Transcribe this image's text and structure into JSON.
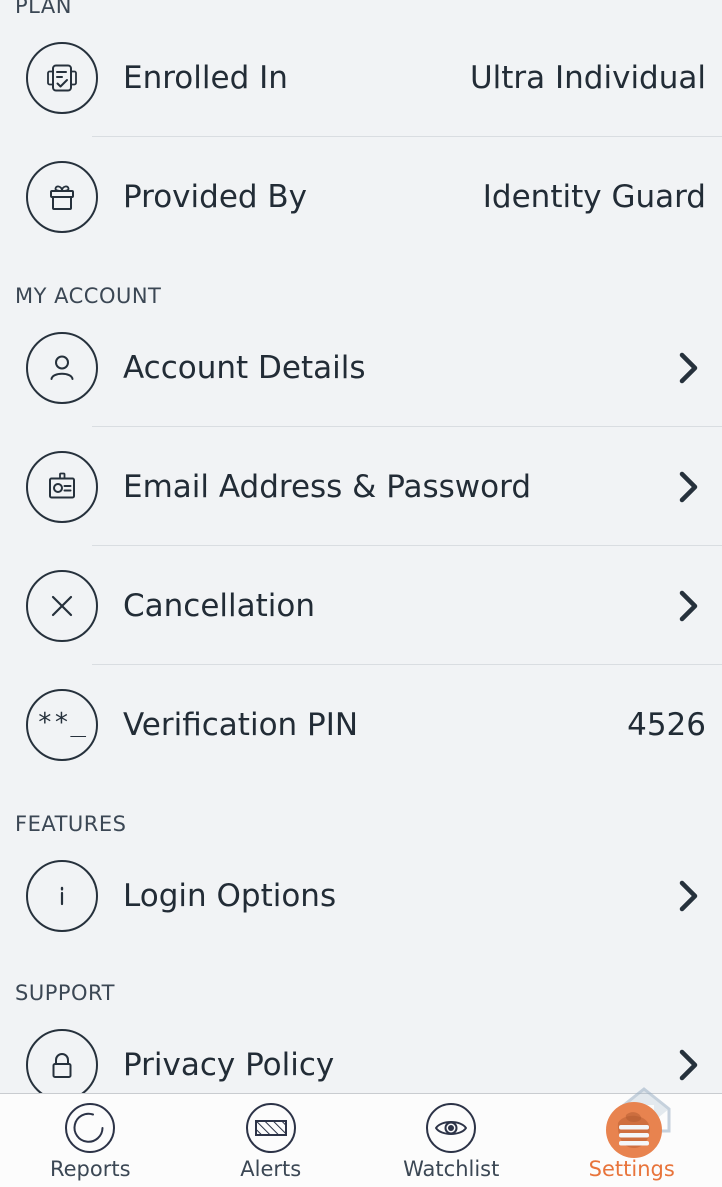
{
  "sections": [
    {
      "id": "plan",
      "header": "PLAN",
      "rows": [
        {
          "icon": "plan-document-icon",
          "label": "Enrolled In",
          "value": "Ultra Individual",
          "accessory": "value",
          "divider": true
        },
        {
          "icon": "gift-icon",
          "label": "Provided By",
          "value": "Identity Guard",
          "accessory": "value",
          "divider": false
        }
      ]
    },
    {
      "id": "my-account",
      "header": "MY ACCOUNT",
      "rows": [
        {
          "icon": "person-icon",
          "label": "Account Details",
          "value": "",
          "accessory": "chevron",
          "divider": true
        },
        {
          "icon": "id-badge-icon",
          "label": "Email Address & Password",
          "value": "",
          "accessory": "chevron",
          "divider": true
        },
        {
          "icon": "close-x-icon",
          "label": "Cancellation",
          "value": "",
          "accessory": "chevron",
          "divider": true
        },
        {
          "icon": "pin-mask-icon",
          "label": "Verification PIN",
          "value": "4526",
          "accessory": "value",
          "divider": false
        }
      ]
    },
    {
      "id": "features",
      "header": "FEATURES",
      "rows": [
        {
          "icon": "info-icon",
          "label": "Login Options",
          "value": "",
          "accessory": "chevron",
          "divider": false
        }
      ]
    },
    {
      "id": "support",
      "header": "SUPPORT",
      "rows": [
        {
          "icon": "lock-icon",
          "label": "Privacy Policy",
          "value": "",
          "accessory": "chevron",
          "divider": true
        }
      ]
    }
  ],
  "pin_icon_glyph": "**_",
  "bottom_nav": {
    "active_color": "#e8743b",
    "items": [
      {
        "id": "reports",
        "label": "Reports",
        "icon": "reports-gauge-icon",
        "active": false
      },
      {
        "id": "alerts",
        "label": "Alerts",
        "icon": "alerts-hatched-icon",
        "active": false
      },
      {
        "id": "watchlist",
        "label": "Watchlist",
        "icon": "eye-icon",
        "active": false
      },
      {
        "id": "settings",
        "label": "Settings",
        "icon": "settings-hand-list-icon",
        "active": true
      }
    ]
  }
}
